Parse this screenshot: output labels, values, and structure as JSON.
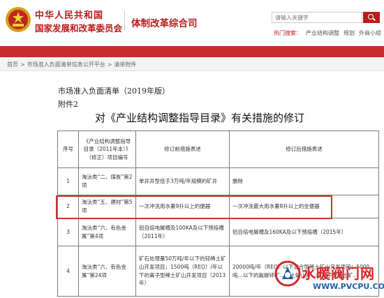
{
  "header": {
    "org_line1": "中华人民共和国",
    "org_line2": "国家发展和改革委员会",
    "department": "体制改革综合司",
    "search_placeholder": "请输入关键字",
    "hot_label": "热门搜索：",
    "hot_items": [
      "产业结构调整",
      "规划",
      "外商小组"
    ]
  },
  "breadcrumb": {
    "items": [
      "首页",
      ">",
      "市场准入负面清单信息公开平台",
      ">",
      "清单附件"
    ]
  },
  "document": {
    "line1": "市场准入负面清单（2019年版）",
    "line2": "附件2",
    "heading": "对《产业结构调整指导目录》有关措施的修订"
  },
  "table": {
    "headers": [
      "序号",
      "《产业结构调整指导目录（2011年本）》（修正）项目编号",
      "修订前措施表述",
      "修订后措施表述"
    ],
    "rows": [
      {
        "num": "1",
        "code": "淘汰类“二、煤炭”第2项",
        "before": "单井井型低于3万吨/年规模的矿井",
        "after": "删除"
      },
      {
        "num": "2",
        "code": "淘汰类“五、建材”第5项",
        "before": "一次冲洗用水量9升以上的便器",
        "after": "一次冲洗最大用水量8升以上的坐便器"
      },
      {
        "num": "3",
        "code": "淘汰类“六、有色金属”第4项",
        "before": "铝自焙电解槽及100KA及以下预焙槽（2011年）",
        "after": "铝自焙电解槽及160KA及以下预焙槽（2015年）"
      },
      {
        "num": "4",
        "code": "淘汰类“六、有色金属”第24项",
        "before": "矿石处理量50万吨/年以下的轻稀土矿山开发项目；1500吨（REO）/年以下的离子型稀土矿山开发项目（2013年）",
        "after": "20000吨/年（REO）以下混合型稀土矿山开发项目；5000吨…以下的氟碳铈矿…稀土矿山开…的离子型稀土矿…"
      }
    ]
  },
  "watermark": {
    "brand": "水暖阀门网",
    "url": "WWW.PVCPU.COM"
  },
  "colors": {
    "brand_red": "#b81c1c",
    "nav_red": "#c92a2a",
    "highlight": "#c0392b"
  }
}
